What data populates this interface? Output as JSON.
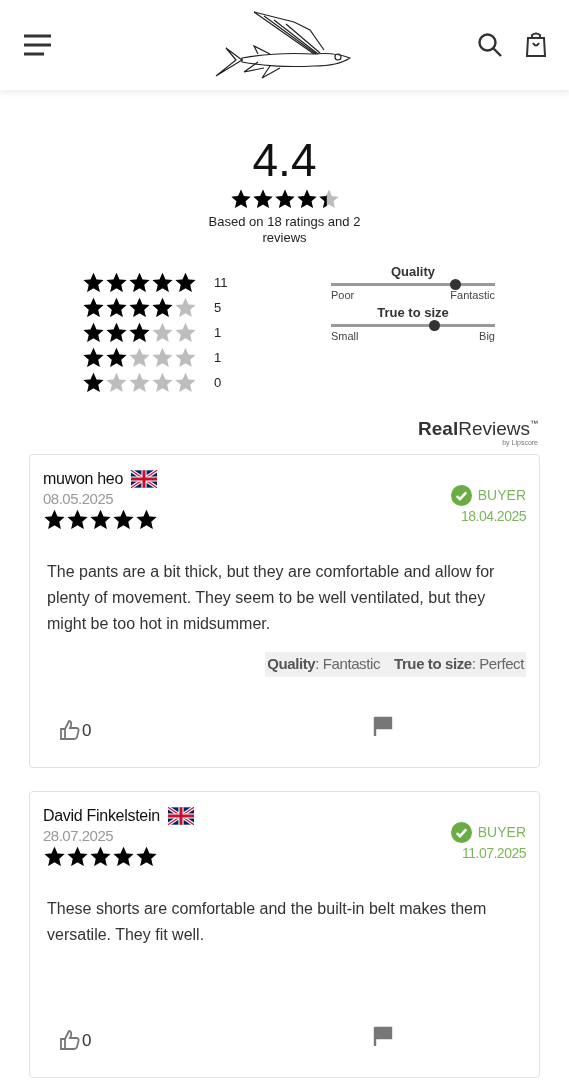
{
  "summary": {
    "score": "4.4",
    "stars": 4.4,
    "caption": "Based on 18 ratings and 2 reviews"
  },
  "distribution": [
    {
      "stars": 5,
      "count": "11"
    },
    {
      "stars": 4,
      "count": "5"
    },
    {
      "stars": 3,
      "count": "1"
    },
    {
      "stars": 2,
      "count": "1"
    },
    {
      "stars": 1,
      "count": "0"
    }
  ],
  "sliders": [
    {
      "title": "Quality",
      "min_label": "Poor",
      "max_label": "Fantastic",
      "level": 0.76
    },
    {
      "title": "True to size",
      "min_label": "Small",
      "max_label": "Big",
      "level": 0.63
    }
  ],
  "brand": {
    "name_bold": "Real",
    "name_light": "Reviews",
    "trademark": "™",
    "byline": "by Lipscore"
  },
  "reviews": [
    {
      "name": "muwon heo",
      "date": "08.05.2025",
      "stars": 5,
      "verified_label": "BUYER",
      "purchase_date": "18.04.2025",
      "text": "The pants are a bit thick, but they are comfortable and allow for plenty of movement. They seem to be well ventilated, but they might be too hot in midsummer.",
      "attributes": [
        "**Quality**: Fantastic",
        "**True to size**: Perfect"
      ],
      "likes": "0"
    },
    {
      "name": "David Finkelstein",
      "date": "28.07.2025",
      "stars": 5,
      "verified_label": "BUYER",
      "purchase_date": "11.07.2025",
      "text": "These shorts are comfortable and the built-in belt makes them versatile. They fit well.",
      "likes": "0"
    }
  ]
}
